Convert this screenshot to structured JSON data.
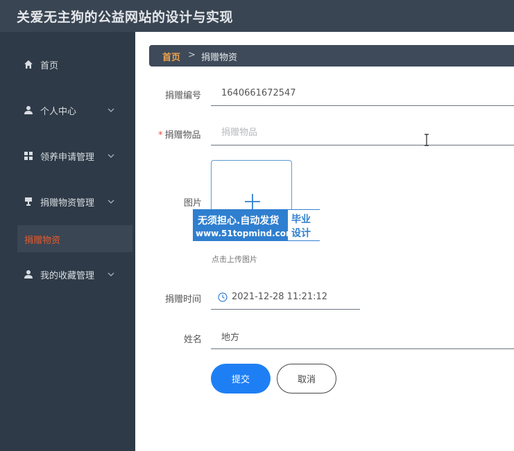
{
  "app": {
    "title": "关爱无主狗的公益网站的设计与实现"
  },
  "sidebar": {
    "items": [
      {
        "label": "首页",
        "icon": "home-icon"
      },
      {
        "label": "个人中心",
        "icon": "user-icon"
      },
      {
        "label": "领养申请管理",
        "icon": "grid-icon"
      },
      {
        "label": "捐赠物资管理",
        "icon": "cup-icon"
      },
      {
        "label": "我的收藏管理",
        "icon": "user-icon"
      }
    ],
    "active_sub": "捐赠物资"
  },
  "breadcrumb": {
    "home": "首页",
    "separator": ">",
    "current": "捐赠物资"
  },
  "form": {
    "donation_no_label": "捐赠编号",
    "donation_no_value": "1640661672547",
    "required_mark": "*",
    "item_label": "捐赠物品",
    "item_placeholder": "捐赠物品",
    "image_label": "图片",
    "upload_hint": "点击上传图片",
    "time_label": "捐赠时间",
    "time_value": "2021-12-28 11:21:12",
    "name_label": "姓名",
    "name_value": "地方",
    "submit_label": "提交",
    "cancel_label": "取消"
  },
  "watermark": {
    "line1": "无须担心.自动发货",
    "line2": "www.51topmind.com",
    "badge1": "毕业",
    "badge2": "设计"
  },
  "colors": {
    "sidebar_bg": "#2e3a47",
    "topbar_bg": "#3a4553",
    "active_text": "#e85a2b",
    "primary": "#1e7ff5",
    "breadcrumb_home": "#f0a34a"
  }
}
